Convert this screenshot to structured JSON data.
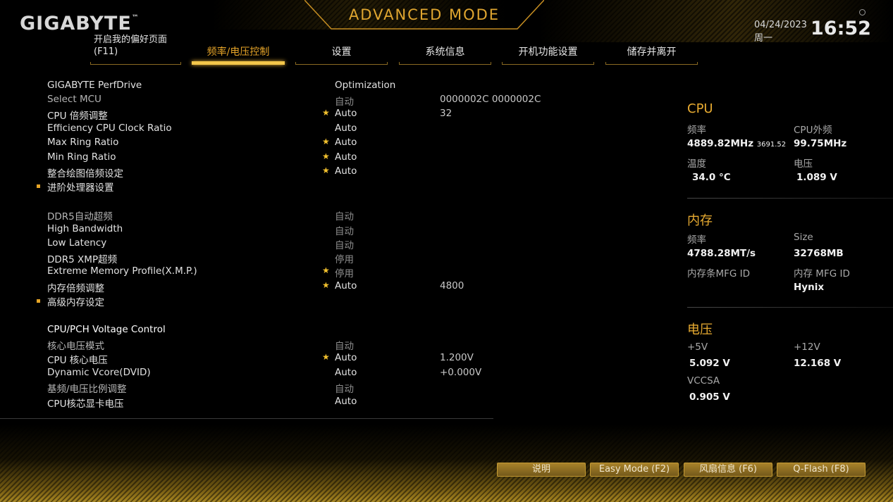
{
  "header": {
    "brand": "GIGABYTE",
    "brand_mark": "™",
    "mode_title": "ADVANCED MODE",
    "date": "04/24/2023",
    "weekday": "周一",
    "time": "16:52"
  },
  "tabs": [
    {
      "label_line1": "开启我的偏好页面",
      "label_line2": "(F11)",
      "active": false
    },
    {
      "label": "频率/电压控制",
      "active": true
    },
    {
      "label": "设置",
      "active": false
    },
    {
      "label": "系统信息",
      "active": false
    },
    {
      "label": "开机功能设置",
      "active": false
    },
    {
      "label": "储存并离开",
      "active": false
    }
  ],
  "settings": {
    "rows": [
      {
        "name": "GIGABYTE PerfDrive",
        "value": "Optimization",
        "extra": "",
        "star": false,
        "muted": false,
        "submenu": false
      },
      {
        "name": "Select MCU",
        "value": "自动",
        "extra": "0000002C 0000002C",
        "star": false,
        "muted": true,
        "submenu": false
      },
      {
        "name": "CPU 倍频调整",
        "value": "Auto",
        "extra": "32",
        "star": true,
        "muted": false,
        "submenu": false
      },
      {
        "name": "Efficiency CPU Clock Ratio",
        "value": "Auto",
        "extra": "",
        "star": false,
        "muted": false,
        "submenu": false
      },
      {
        "name": "Max Ring Ratio",
        "value": "Auto",
        "extra": "",
        "star": true,
        "muted": false,
        "submenu": false
      },
      {
        "name": "Min Ring Ratio",
        "value": "Auto",
        "extra": "",
        "star": true,
        "muted": false,
        "submenu": false
      },
      {
        "name": "整合绘图倍频设定",
        "value": "Auto",
        "extra": "",
        "star": true,
        "muted": false,
        "submenu": false
      },
      {
        "name": "进阶处理器设置",
        "value": "",
        "extra": "",
        "star": false,
        "muted": false,
        "submenu": true
      },
      {
        "name": "DDR5自动超频",
        "value": "自动",
        "extra": "",
        "star": false,
        "muted": true,
        "submenu": false
      },
      {
        "name": "High Bandwidth",
        "value": "自动",
        "extra": "",
        "star": false,
        "muted": true,
        "submenu": false
      },
      {
        "name": "Low Latency",
        "value": "自动",
        "extra": "",
        "star": false,
        "muted": true,
        "submenu": false
      },
      {
        "name": "DDR5 XMP超频",
        "value": "停用",
        "extra": "",
        "star": false,
        "muted": true,
        "submenu": false
      },
      {
        "name": "Extreme Memory Profile(X.M.P.)",
        "value": "停用",
        "extra": "",
        "star": true,
        "muted": true,
        "submenu": false
      },
      {
        "name": "内存倍频调整",
        "value": "Auto",
        "extra": "4800",
        "star": true,
        "muted": false,
        "submenu": false
      },
      {
        "name": "高级内存设定",
        "value": "",
        "extra": "",
        "star": false,
        "muted": false,
        "submenu": true
      },
      {
        "name": "CPU/PCH Voltage Control",
        "value": "",
        "extra": "",
        "star": false,
        "muted": false,
        "submenu": false,
        "header": true
      },
      {
        "name": "核心电压模式",
        "value": "自动",
        "extra": "",
        "star": false,
        "muted": true,
        "submenu": false
      },
      {
        "name": "CPU 核心电压",
        "value": "Auto",
        "extra": "1.200V",
        "star": true,
        "muted": false,
        "submenu": false
      },
      {
        "name": "Dynamic Vcore(DVID)",
        "value": "Auto",
        "extra": "+0.000V",
        "star": false,
        "muted": false,
        "submenu": false
      },
      {
        "name": "基频/电压比例调整",
        "value": "自动",
        "extra": "",
        "star": false,
        "muted": true,
        "submenu": false
      },
      {
        "name": "CPU核芯显卡电压",
        "value": "Auto",
        "extra": "",
        "star": false,
        "muted": false,
        "submenu": false
      }
    ]
  },
  "info": {
    "cpu": {
      "title": "CPU",
      "freq_label": "频率",
      "freq_value": "4889.82MHz",
      "freq_sub": "3691.52",
      "bclk_label": "CPU外频",
      "bclk_value": "99.75MHz",
      "temp_label": "温度",
      "temp_value": "34.0 °C",
      "volt_label": "电压",
      "volt_value": "1.089 V"
    },
    "memory": {
      "title": "内存",
      "freq_label": "频率",
      "freq_value": "4788.28MT/s",
      "size_label": "Size",
      "size_value": "32768MB",
      "dimm_mfg_label": "内存条MFG ID",
      "mfg_label": "内存 MFG ID",
      "mfg_value": "Hynix"
    },
    "voltage": {
      "title": "电压",
      "v5_label": "+5V",
      "v5_value": "5.092 V",
      "v12_label": "+12V",
      "v12_value": "12.168 V",
      "vccsa_label": "VCCSA",
      "vccsa_value": "0.905 V"
    }
  },
  "buttons": {
    "help": "说明",
    "easy_mode": "Easy Mode (F2)",
    "fan_info": "风扇信息 (F6)",
    "qflash": "Q-Flash (F8)"
  }
}
